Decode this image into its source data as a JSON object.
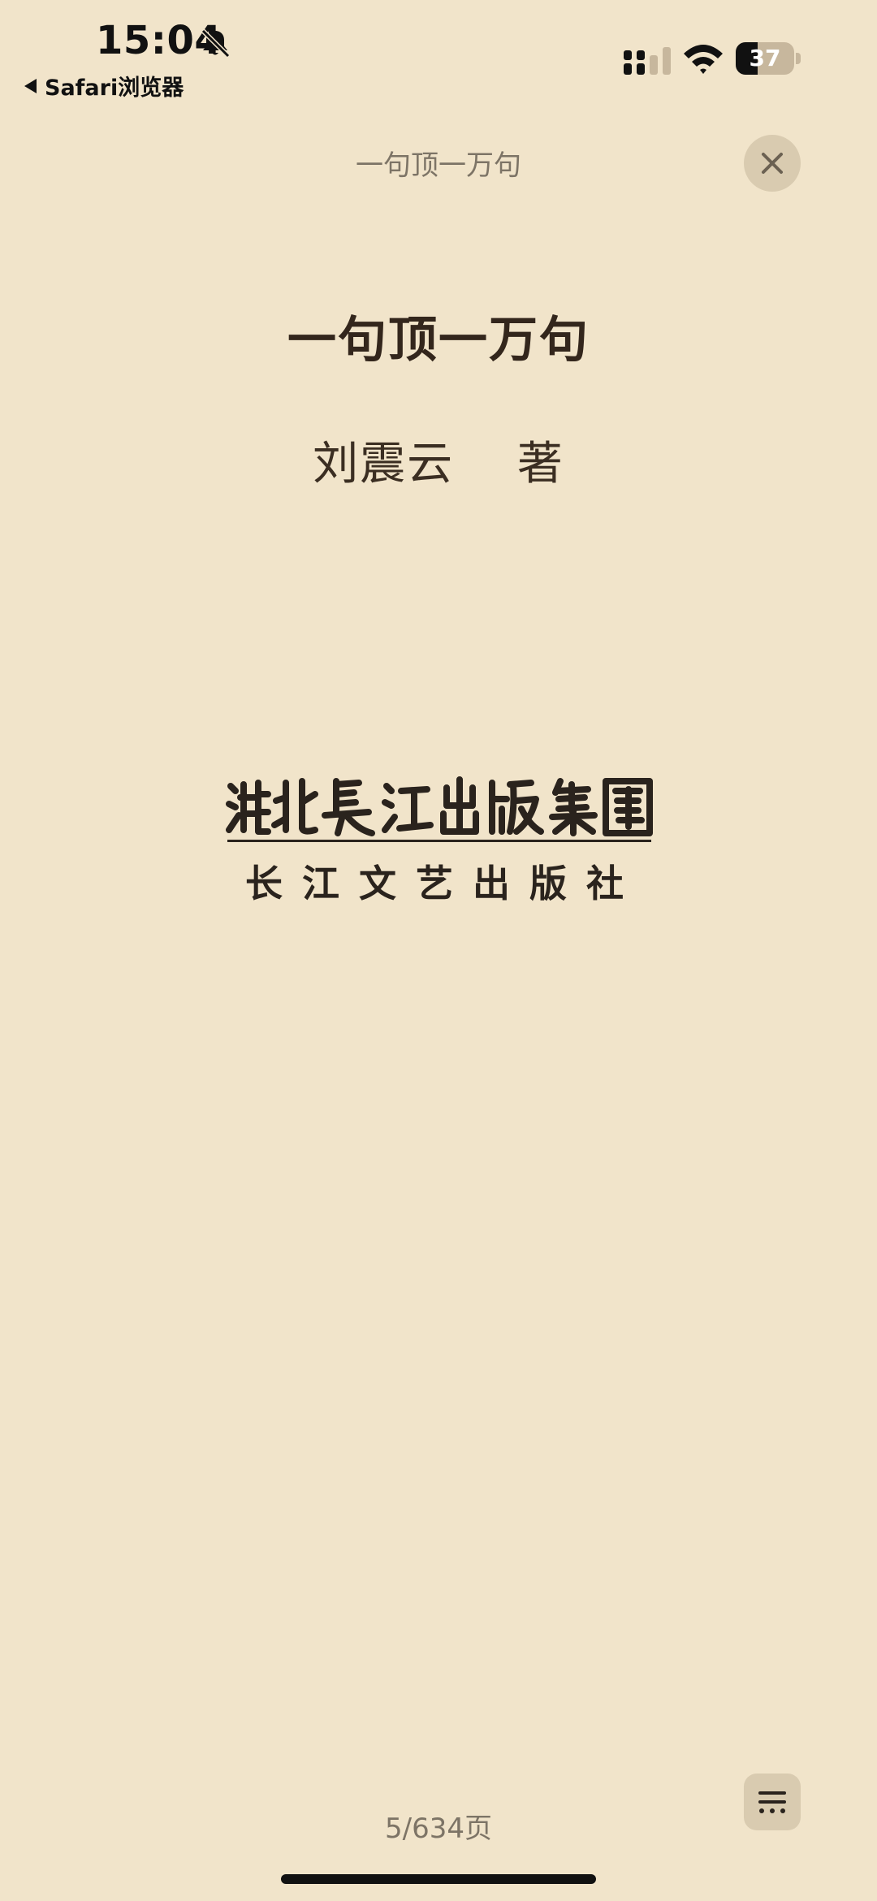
{
  "status_bar": {
    "time": "15:04",
    "back_label": "Safari浏览器",
    "battery": "37",
    "battery_level": 0.37,
    "icons": [
      "bell-slash-icon",
      "signal-icon",
      "wifi-icon",
      "battery-icon"
    ]
  },
  "nav": {
    "title": "一句顶一万句",
    "close_icon": "close-icon"
  },
  "book": {
    "title": "一句顶一万句",
    "author": "刘震云　 著"
  },
  "publisher": {
    "logo_name": "湖北長江出版集團",
    "name": "长江文艺出版社"
  },
  "footer": {
    "page_indicator": "5/634页",
    "menu_icon": "menu-icon"
  },
  "colors": {
    "background": "#F1E4CA",
    "button_bg": "#D9CBB0",
    "muted_text": "#7D7466",
    "title_text": "#33261C"
  }
}
